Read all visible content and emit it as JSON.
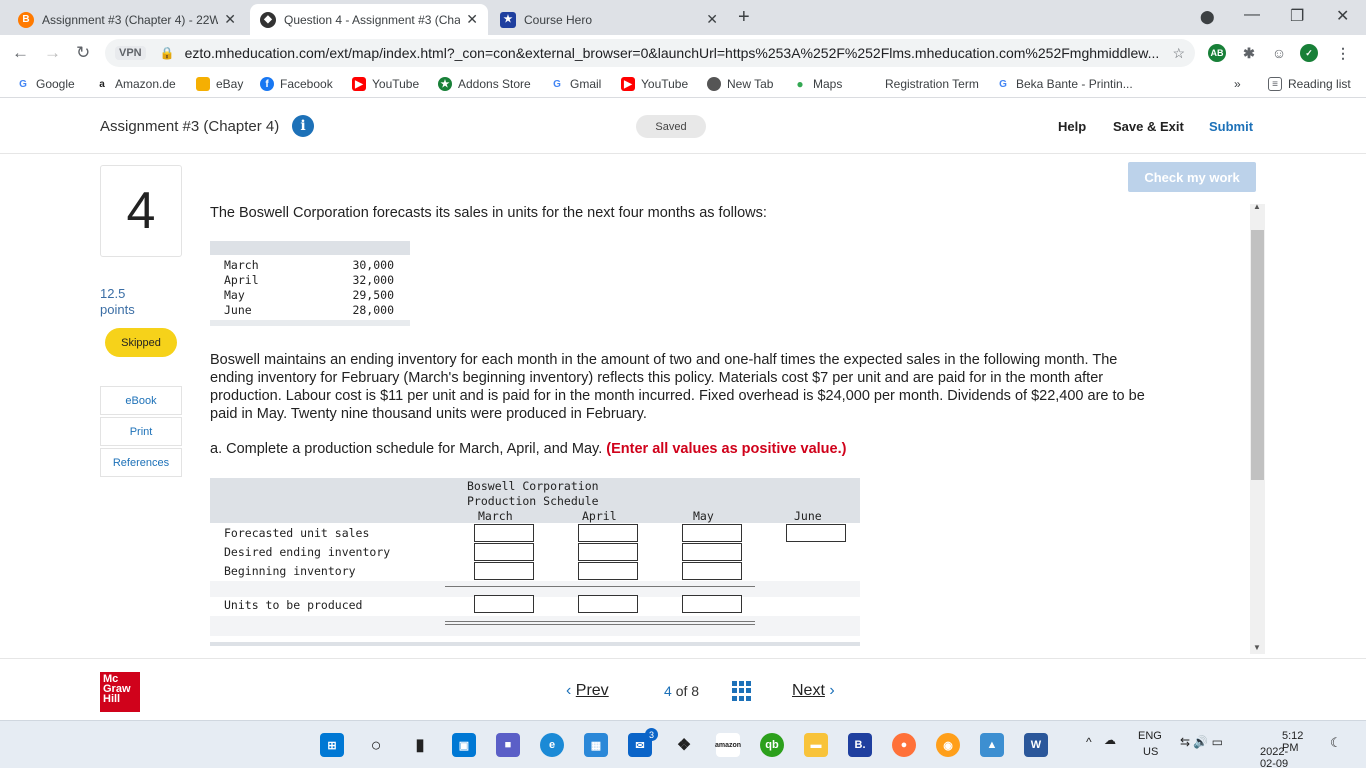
{
  "browser": {
    "tabs": [
      {
        "title": "Assignment #3 (Chapter 4) - 22W",
        "active": false,
        "favicon_color": "#ff7a00",
        "favicon_text": "B"
      },
      {
        "title": "Question 4 - Assignment #3 (Cha",
        "active": true,
        "favicon_color": "#333333",
        "favicon_text": ""
      },
      {
        "title": "Course Hero",
        "active": false,
        "favicon_color": "#1f3f9f",
        "favicon_text": "★"
      }
    ],
    "new_tab_label": "+",
    "vpn_label": "VPN",
    "url": "ezto.mheducation.com/ext/map/index.html?_con=con&external_browser=0&launchUrl=https%253A%252F%252Flms.mheducation.com%252Fmghmiddlew...",
    "bookmarks": [
      {
        "label": "Google",
        "icon_text": "G",
        "color": "#4285f4"
      },
      {
        "label": "Amazon.de",
        "icon_text": "a",
        "color": "#222222"
      },
      {
        "label": "eBay",
        "icon_text": "🛍",
        "color": "#e53238"
      },
      {
        "label": "Facebook",
        "icon_text": "f",
        "color": "#1877f2"
      },
      {
        "label": "YouTube",
        "icon_text": "▶",
        "color": "#ff0000"
      },
      {
        "label": "Addons Store",
        "icon_text": "★",
        "color": "#188038"
      },
      {
        "label": "Gmail",
        "icon_text": "G",
        "color": "#4285f4"
      },
      {
        "label": "YouTube",
        "icon_text": "▶",
        "color": "#ff0000"
      },
      {
        "label": "New Tab",
        "icon_text": "●",
        "color": "#555555"
      },
      {
        "label": "Maps",
        "icon_text": "⬤",
        "color": "#34a853"
      },
      {
        "label": "Registration Term",
        "icon_text": "",
        "color": "#ffffff"
      },
      {
        "label": "Beka Bante - Printin...",
        "icon_text": "G",
        "color": "#4285f4"
      }
    ],
    "more_bookmarks": "»",
    "reading_list": "Reading list"
  },
  "header": {
    "assignment_title": "Assignment #3 (Chapter 4)",
    "info_icon": "i",
    "saved_label": "Saved",
    "help_label": "Help",
    "save_exit_label": "Save & Exit",
    "submit_label": "Submit"
  },
  "rail": {
    "question_number": "4",
    "points_value": "12.5",
    "points_label": "points",
    "status_badge": "Skipped",
    "links": [
      "eBook",
      "Print",
      "References"
    ]
  },
  "content": {
    "check_work_label": "Check my work",
    "intro": "The Boswell Corporation forecasts its sales in units for the next four months as follows:",
    "sales": [
      {
        "month": "March",
        "units": "30,000"
      },
      {
        "month": "April",
        "units": "32,000"
      },
      {
        "month": "May",
        "units": "29,500"
      },
      {
        "month": "June",
        "units": "28,000"
      }
    ],
    "paragraph": "Boswell maintains an ending inventory for each month in the amount of two and one-half times the expected sales in the following month. The ending inventory for February (March's beginning inventory) reflects this policy. Materials cost $7 per unit and are paid for in the month after production. Labour cost is $11 per unit and is paid for in the month incurred. Fixed overhead is $24,000 per month. Dividends of $22,400 are to be paid in May. Twenty nine thousand units were produced in February.",
    "part_a_prefix": "a. Complete a production schedule for March, April, and May.",
    "part_a_instruction": "(Enter all values as positive value.)",
    "schedule": {
      "company": "Boswell Corporation",
      "title": "Production Schedule",
      "columns": [
        "March",
        "April",
        "May",
        "June"
      ],
      "rows": [
        "Forecasted unit sales",
        "Desired ending inventory",
        "Beginning inventory",
        "Units to be produced"
      ]
    }
  },
  "footer": {
    "prev_label": "Prev",
    "next_label": "Next",
    "page_current": "4",
    "page_of": "of",
    "page_total": "8",
    "logo_lines": [
      "Mc",
      "Graw",
      "Hill"
    ]
  },
  "taskbar": {
    "lang": "ENG",
    "region": "US",
    "time": "5:12 PM",
    "date": "2022-02-09",
    "mail_badge": "3"
  }
}
